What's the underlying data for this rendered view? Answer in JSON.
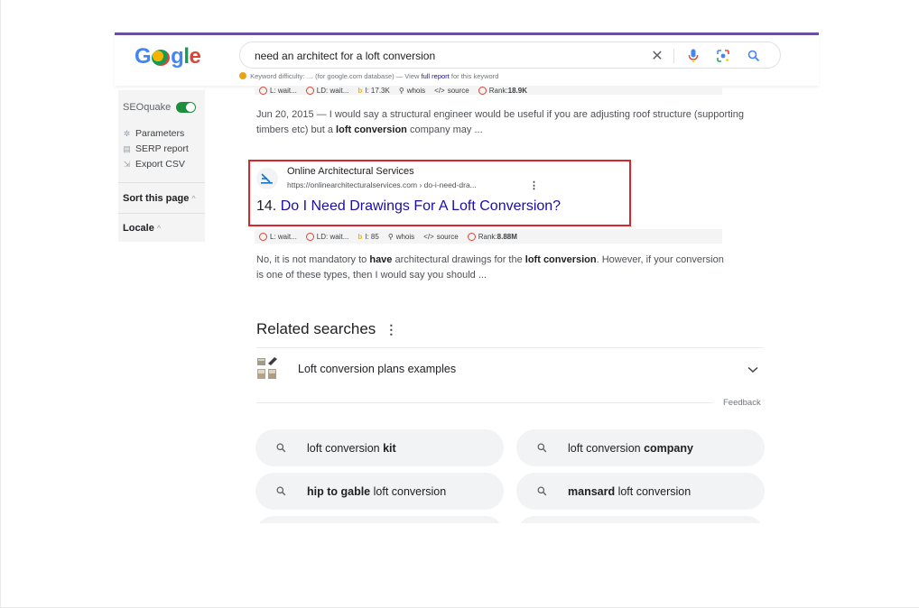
{
  "header": {
    "logo": {
      "g": "G",
      "g2": "g",
      "l": "l",
      "e": "e"
    },
    "search": {
      "value": "need an architect for a loft conversion"
    },
    "keyword_difficulty": {
      "prefix": "Keyword difficulty: ",
      "value": "…",
      "middle": " (for google.com database) — View ",
      "link": "full report",
      "suffix": " for this keyword"
    }
  },
  "sidebar": {
    "seoquake_label": "SEOquake",
    "items": [
      {
        "label": "Parameters",
        "icon": "gear-icon"
      },
      {
        "label": "SERP report",
        "icon": "list-icon"
      },
      {
        "label": "Export CSV",
        "icon": "export-icon"
      }
    ],
    "sort_label": "Sort this page",
    "locale_label": "Locale"
  },
  "seo_bar_top": {
    "l": "L: wait...",
    "ld": "LD: wait...",
    "bing": "I: 17.3K",
    "whois": "whois",
    "source": "source",
    "rank_label": "Rank: ",
    "rank_value": "18.9K"
  },
  "snippet_top": {
    "date": "Jun 20, 2015",
    "text1": " — I would say a structural engineer would be useful if you are adjusting roof structure (supporting timbers etc) but a ",
    "bold": "loft conversion",
    "text2": " company may ..."
  },
  "result": {
    "site_name": "Online Architectural Services",
    "url": "https://onlinearchitecturalservices.com › do-i-need-dra...",
    "number": "14.",
    "title": "Do I Need Drawings For A Loft Conversion?"
  },
  "seo_bar_result": {
    "l": "L: wait...",
    "ld": "LD: wait...",
    "bing": "I: 85",
    "whois": "whois",
    "source": "source",
    "rank_label": "Rank: ",
    "rank_value": "8.88M"
  },
  "snippet_result": {
    "t1": "No, it is not mandatory to ",
    "b1": "have",
    "t2": " architectural drawings for the ",
    "b2": "loft conversion",
    "t3": ". However, if your conversion is one of these types, then I would say you should ..."
  },
  "related": {
    "heading": "Related searches",
    "item": "Loft conversion plans examples",
    "feedback": "Feedback",
    "chips": [
      {
        "plain_before": "loft conversion ",
        "bold": "kit",
        "plain_after": ""
      },
      {
        "plain_before": "loft conversion ",
        "bold": "company",
        "plain_after": ""
      },
      {
        "plain_before": "",
        "bold": "hip to gable",
        "plain_after": " loft conversion"
      },
      {
        "plain_before": "",
        "bold": "mansard",
        "plain_after": " loft conversion"
      }
    ]
  },
  "colors": {
    "accent": "#6b4fa0",
    "link": "#1a0dab",
    "highlight_border": "#d8262e",
    "toggle_on": "#1e8e3e"
  }
}
